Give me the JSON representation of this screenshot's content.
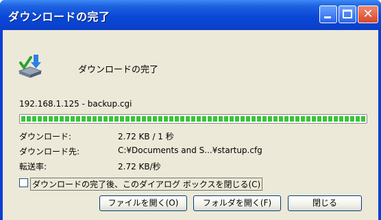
{
  "window": {
    "title": "ダウンロードの完了"
  },
  "dialog": {
    "heading": "ダウンロードの完了",
    "source": "192.168.1.125 - backup.cgi",
    "progress_fraction": 1.0,
    "details": [
      {
        "label": "ダウンロード:",
        "value": "2.72 KB / 1 秒"
      },
      {
        "label": "ダウンロード先:",
        "value": "C:¥Documents and S...¥startup.cfg"
      },
      {
        "label": "転送率:",
        "value": "2.72 KB/秒"
      }
    ],
    "close_checkbox": {
      "label": "ダウンロードの完了後、このダイアログ ボックスを閉じる(C)",
      "checked": false
    },
    "buttons": {
      "open_file": "ファイルを開く(O)",
      "open_folder": "フォルダを開く(F)",
      "close": "閉じる"
    }
  },
  "colors": {
    "titlebar": "#0a48d8",
    "progress": "#39c439",
    "client_bg": "#ece9d8"
  },
  "icons": {
    "title_buttons": [
      "minimize-icon",
      "maximize-icon",
      "close-icon"
    ],
    "dialog": "download-complete-icon"
  }
}
